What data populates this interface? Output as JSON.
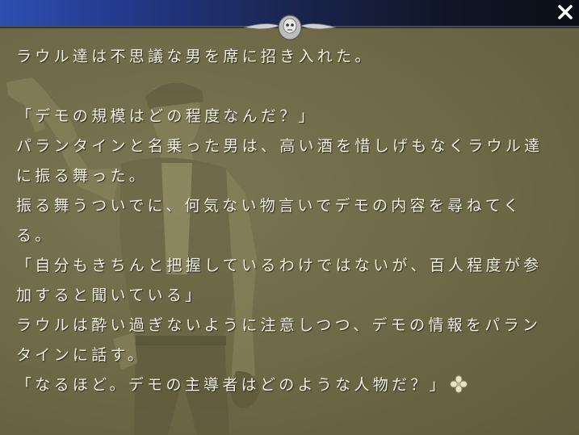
{
  "window": {
    "close_icon": "close-icon",
    "title_color_left": "#2e4fb0",
    "title_color_right": "#0b0e16"
  },
  "message": {
    "lines": [
      "ラウル達は不思議な男を席に招き入れた。",
      "",
      "「デモの規模はどの程度なんだ？」",
      "パランタインと名乗った男は、高い酒を惜しげもなくラウル達",
      "に振る舞った。",
      "振る舞うついでに、何気ない物言いでデモの内容を尋ねてく",
      "る。",
      "「自分もきちんと把握しているわけではないが、百人程度が参",
      "加すると聞いている」",
      "ラウルは酔い過ぎないように注意しつつ、デモの情報をパラン",
      "タインに話す。",
      "「なるほど。デモの主導者はどのような人物だ？」"
    ],
    "next_indicator_icon": "flower-cursor-icon",
    "text_color": "#f4f1e4",
    "background_color": "#6e6a48"
  },
  "portrait": {
    "icon": "character-portrait"
  },
  "ornament": {
    "icon": "skull-ornament-icon"
  }
}
